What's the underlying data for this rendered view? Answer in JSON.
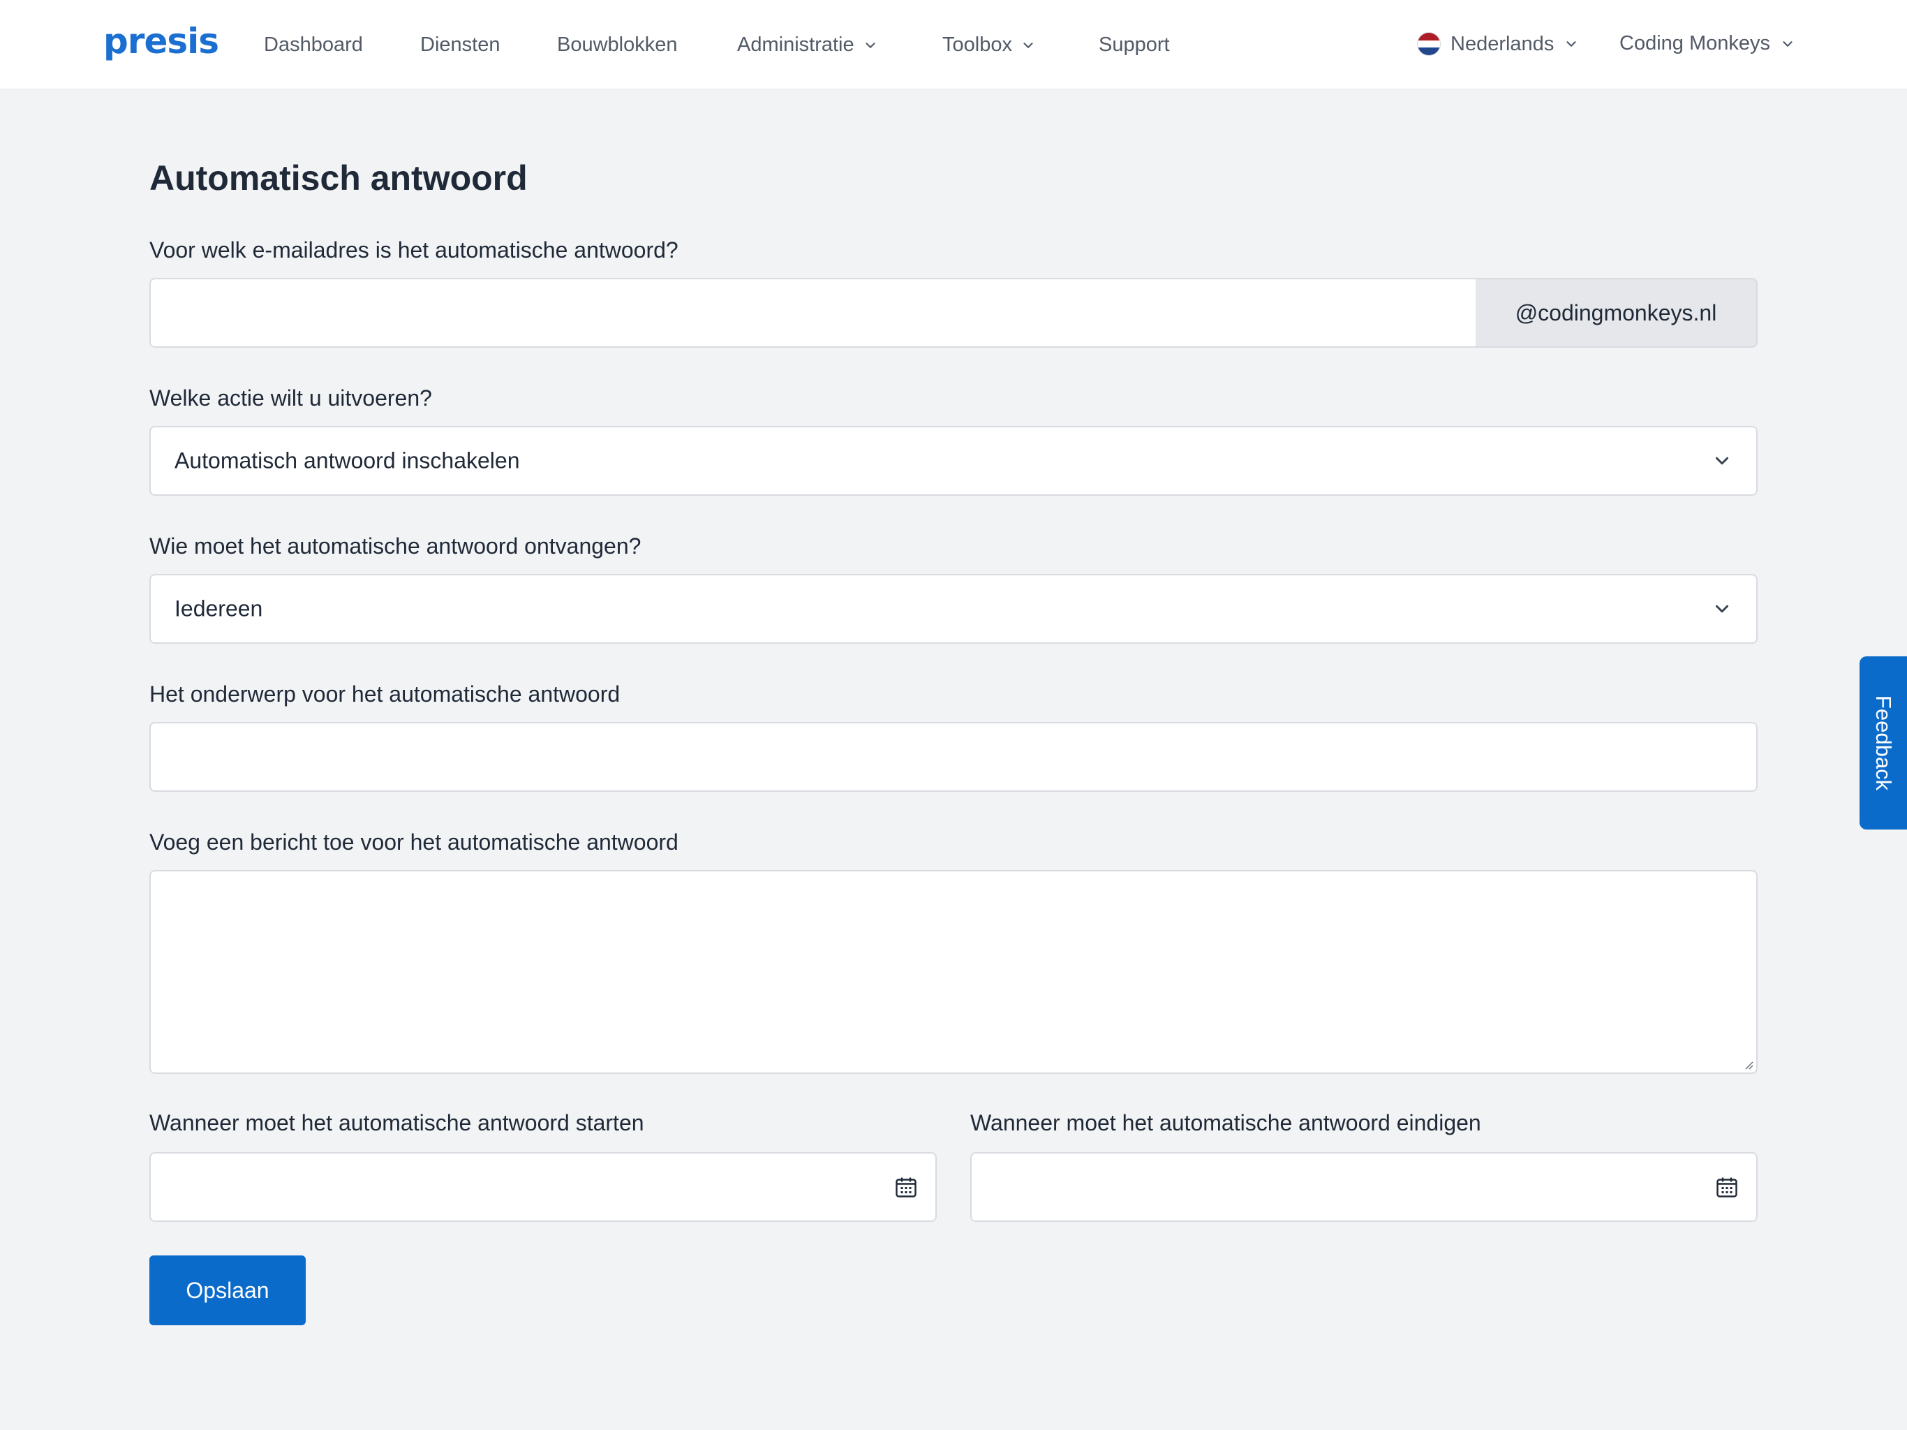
{
  "header": {
    "logo": "presis",
    "nav": [
      {
        "label": "Dashboard"
      },
      {
        "label": "Diensten"
      },
      {
        "label": "Bouwblokken"
      },
      {
        "label": "Administratie"
      },
      {
        "label": "Toolbox"
      },
      {
        "label": "Support"
      }
    ],
    "language": "Nederlands",
    "account": "Coding Monkeys"
  },
  "form": {
    "title": "Automatisch antwoord",
    "email": {
      "label": "Voor welk e-mailadres is het automatische antwoord?",
      "value": "",
      "domain_suffix": "@codingmonkeys.nl"
    },
    "action": {
      "label": "Welke actie wilt u uitvoeren?",
      "selected": "Automatisch antwoord inschakelen"
    },
    "recipients": {
      "label": "Wie moet het automatische antwoord ontvangen?",
      "selected": "Iedereen"
    },
    "subject": {
      "label": "Het onderwerp voor het automatische antwoord",
      "value": ""
    },
    "message": {
      "label": "Voeg een bericht toe voor het automatische antwoord",
      "value": ""
    },
    "start": {
      "label": "Wanneer moet het automatische antwoord starten",
      "value": ""
    },
    "end": {
      "label": "Wanneer moet het automatische antwoord eindigen",
      "value": ""
    },
    "save_label": "Opslaan"
  },
  "feedback_label": "Feedback",
  "colors": {
    "accent": "#0b6bcb",
    "background": "#f2f3f5"
  }
}
